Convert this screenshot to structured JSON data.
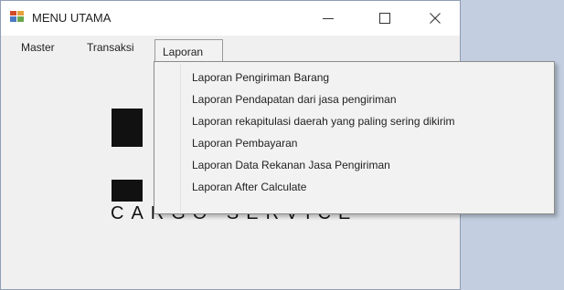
{
  "window": {
    "title": "MENU UTAMA",
    "controls": [
      "minimize-icon",
      "maximize-icon",
      "close-icon"
    ]
  },
  "menubar": {
    "items": [
      "Master",
      "Transaksi",
      "Laporan"
    ],
    "open_menu": "Laporan"
  },
  "dropdown": {
    "items": [
      "Laporan Pengiriman Barang",
      "Laporan Pendapatan dari jasa pengiriman",
      "Laporan rekapitulasi daerah yang paling sering dikirim",
      "Laporan Pembayaran",
      "Laporan Data Rekanan Jasa Pengiriman",
      "Laporan After Calculate"
    ]
  },
  "logo": {
    "text": "CARGO SERVICE"
  },
  "colors": {
    "desktop": "#bac8dc",
    "window": "#f0f0f0",
    "dropdown": "#f2f2f2"
  }
}
